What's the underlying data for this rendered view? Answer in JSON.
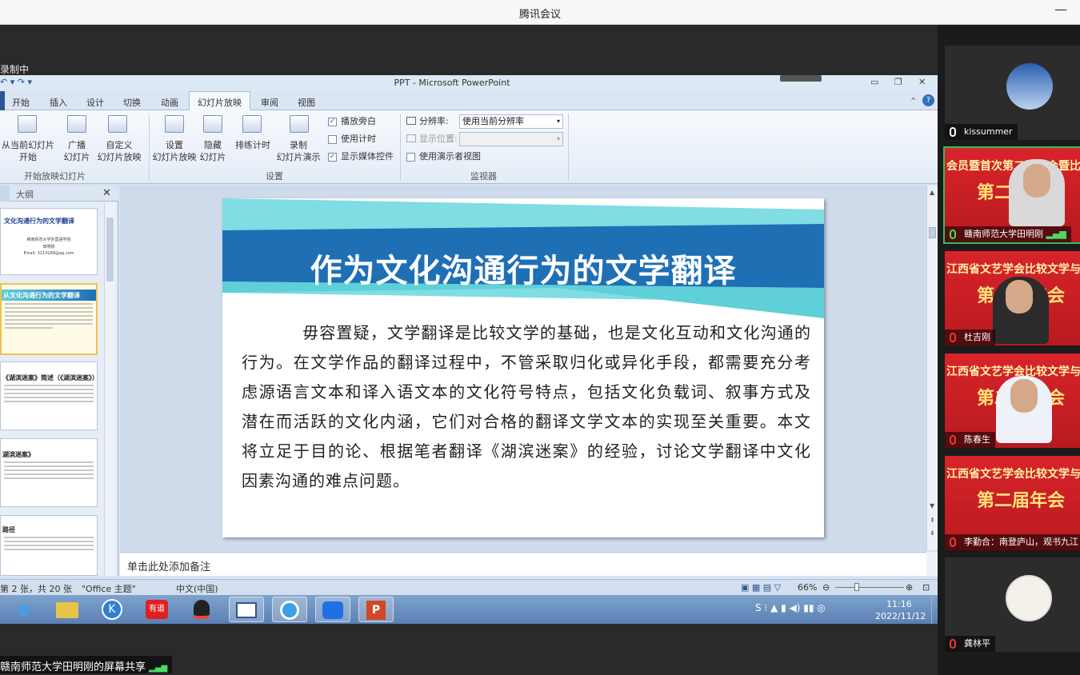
{
  "app": {
    "title": "腾讯会议",
    "recording_label": "录制中",
    "share_label": "赣南师范大学田明刚的屏幕共享"
  },
  "ppt": {
    "window_title": "PPT  -  Microsoft PowerPoint",
    "tabs": [
      "开始",
      "插入",
      "设计",
      "切换",
      "动画",
      "幻灯片放映",
      "审阅",
      "视图"
    ],
    "active_tab": "幻灯片放映",
    "ribbon": {
      "from_current_l1": "从当前幻灯片",
      "from_current_l2": "开始",
      "broadcast_l1": "广播",
      "broadcast_l2": "幻灯片",
      "custom_l1": "自定义",
      "custom_l2": "幻灯片放映",
      "group1": "开始放映幻灯片",
      "setup_l1": "设置",
      "setup_l2": "幻灯片放映",
      "hide_l1": "隐藏",
      "hide_l2": "幻灯片",
      "rehearse": "排练计时",
      "record_l1": "录制",
      "record_l2": "幻灯片演示",
      "play_narration": "播放旁白",
      "use_timings": "使用计时",
      "show_media": "显示媒体控件",
      "group2": "设置",
      "resolution_label": "分辨率:",
      "resolution_value": "使用当前分辨率",
      "show_on_label": "显示位置:",
      "presenter_view": "使用演示者视图",
      "group3": "监视器"
    },
    "pane": {
      "outline_tab": "大纲"
    },
    "thumbnails": [
      {
        "title": "文化沟通行为的文学翻译",
        "sub1": "赣南师范大学外国语学院",
        "sub2": "田明刚",
        "sub3": "Email: 3114188@qq.com"
      },
      {
        "title": "从文化沟通行为的文学翻译"
      },
      {
        "title": "《湖滨迷案》简述（《湖滨迷案》）"
      },
      {
        "title": "湖滨迷案》"
      },
      {
        "title": "路径"
      }
    ],
    "slide": {
      "title": "作为文化沟通行为的文学翻译",
      "body": "毋容置疑，文学翻译是比较文学的基础，也是文化互动和文化沟通的行为。在文学作品的翻译过程中，不管采取归化或异化手段，都需要充分考虑源语言文本和译入语文本的文化符号特点，包括文化负载词、叙事方式及潜在而活跃的文化内涵，它们对合格的翻译文学文本的实现至关重要。本文将立足于目的论、根据笔者翻译《湖滨迷案》的经验，讨论文学翻译中文化因素沟通的难点问题。"
    },
    "notes_placeholder": "单击此处添加备注",
    "status": {
      "slide_count": "第 2 张，共 20 张",
      "theme": "\"Office 主题\"",
      "language": "中文(中国)",
      "zoom": "66%"
    }
  },
  "taskbar": {
    "apps": [
      "ie",
      "explorer",
      "k-app",
      "youdao",
      "qq",
      "ppt-window",
      "browser",
      "tencent-meeting",
      "powerpoint"
    ],
    "youdao_label": "有道",
    "time": "11:16",
    "date": "2022/11/12"
  },
  "participants": [
    {
      "name": "kissummer",
      "kind": "avatar"
    },
    {
      "name": "赣南师范大学田明刚",
      "kind": "video",
      "active": true
    },
    {
      "name": "杜吉刚",
      "kind": "video"
    },
    {
      "name": "陈春生",
      "kind": "video"
    },
    {
      "name": "李勤合：南登庐山，观书九江",
      "kind": "video"
    },
    {
      "name": "龚林平",
      "kind": "avatar"
    }
  ],
  "banners": {
    "line1": "江西省文艺学会比较文学与跨文化专业",
    "line1b": "会员暨首次第二届年会暨比较文学与跨文化专业",
    "big": "第二届年会"
  },
  "colors": {
    "accent_blue": "#1f6fb5",
    "teal": "#5fd0d8",
    "active_border": "#2fbf5a",
    "banner_red": "#d8242a"
  }
}
